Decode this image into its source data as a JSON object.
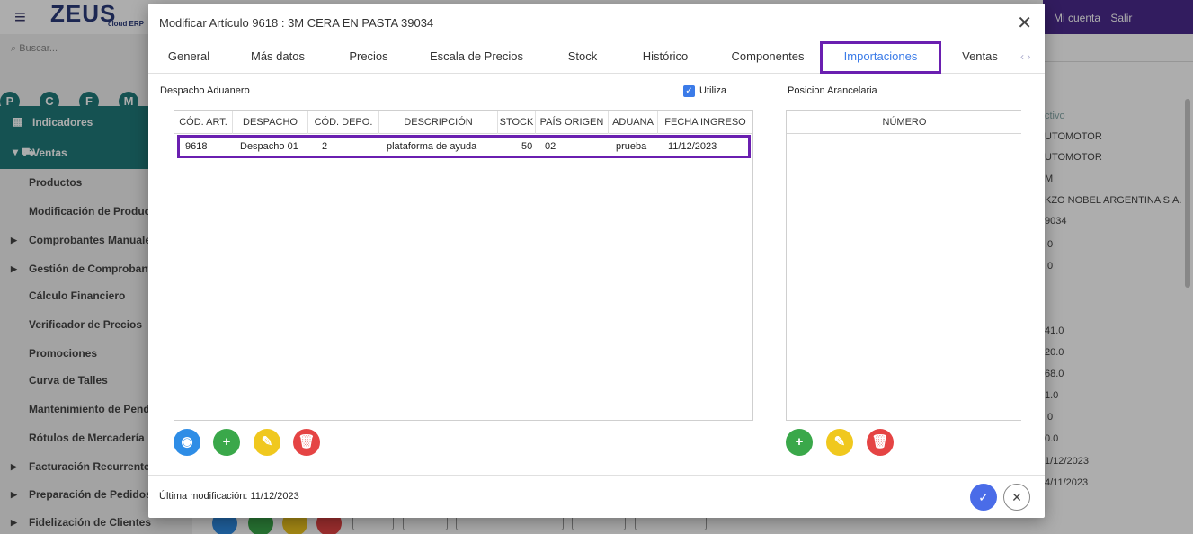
{
  "app": {
    "logo": "ZEUS",
    "logo_sub": "cloud ERP",
    "account_link": "Mi cuenta",
    "logout_link": "Salir",
    "search_placeholder": "Buscar...",
    "quick_buttons": [
      "P",
      "C",
      "F",
      "M"
    ]
  },
  "sidebar": {
    "section_indicadores": "Indicadores",
    "section_ventas": "Ventas",
    "items": [
      {
        "label": "Productos",
        "expandable": false
      },
      {
        "label": "Modificación de Productos",
        "expandable": false
      },
      {
        "label": "Comprobantes Manuales",
        "expandable": true
      },
      {
        "label": "Gestión de Comprobantes",
        "expandable": true
      },
      {
        "label": "Cálculo Financiero",
        "expandable": false
      },
      {
        "label": "Verificador de Precios",
        "expandable": false
      },
      {
        "label": "Promociones",
        "expandable": false
      },
      {
        "label": "Curva de Talles",
        "expandable": false
      },
      {
        "label": "Mantenimiento de Pendientes",
        "expandable": false
      },
      {
        "label": "Rótulos de Mercadería",
        "expandable": false
      },
      {
        "label": "Facturación Recurrente",
        "expandable": true
      },
      {
        "label": "Preparación de Pedidos",
        "expandable": true
      },
      {
        "label": "Fidelización de Clientes",
        "expandable": true
      }
    ]
  },
  "background_panel": {
    "values": [
      "ctivo",
      "UTOMOTOR",
      "UTOMOTOR",
      "M",
      "KZO NOBEL ARGENTINA S.A.",
      "9034",
      ".0",
      ".0",
      "41.0",
      "20.0",
      "68.0",
      "1.0",
      ".0",
      "0.0",
      "1/12/2023",
      "4/11/2023"
    ]
  },
  "dialog": {
    "title": "Modificar Artículo 9618 : 3M CERA EN PASTA 39034",
    "tabs": [
      "General",
      "Más datos",
      "Precios",
      "Escala de Precios",
      "Stock",
      "Histórico",
      "Componentes",
      "Importaciones",
      "Ventas"
    ],
    "active_tab": "Importaciones",
    "despacho_label": "Despacho Aduanero",
    "utiliza_label": "Utiliza",
    "utiliza_checked": true,
    "posicion_label": "Posicion Arancelaria",
    "despacho_table": {
      "headers": [
        "CÓD. ART.",
        "DESPACHO",
        "CÓD. DEPO.",
        "DESCRIPCIÓN",
        "STOCK",
        "PAÍS ORIGEN",
        "ADUANA",
        "FECHA INGRESO"
      ],
      "rows": [
        [
          "9618",
          "Despacho 01",
          "2",
          "plataforma de ayuda",
          "50",
          "02",
          "prueba",
          "11/12/2023"
        ]
      ]
    },
    "posicion_table": {
      "headers": [
        "NÚMERO"
      ],
      "rows": []
    },
    "footer": "Última modificación: 11/12/2023"
  },
  "colors": {
    "accent_purple": "#6a1fb0",
    "tab_active_text": "#3b7be8",
    "sidebar_teal": "#1f7a7a"
  }
}
